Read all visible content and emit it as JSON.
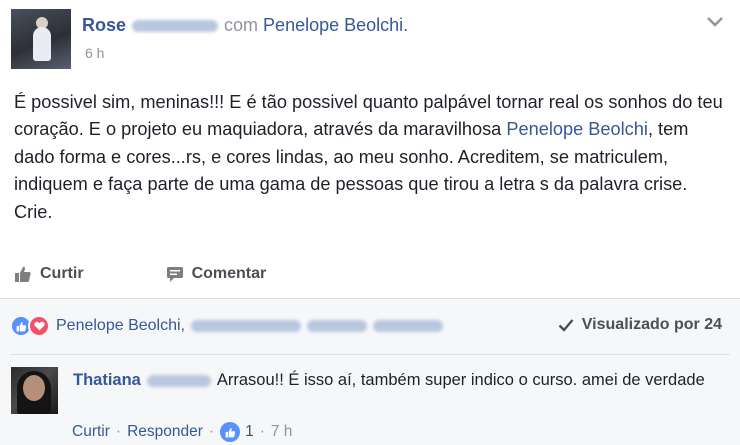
{
  "post": {
    "author_first": "Rose",
    "with_text": "com",
    "tagged": "Penelope Beolchi.",
    "time": "6 h",
    "text_before_link": "É possivel sim, meninas!!! E é tão possivel quanto palpável tornar real os sonhos do teu coração. E o projeto eu maquiadora, através da maravilhosa ",
    "text_link": "Penelope Beolchi",
    "text_after_link": ", tem dado forma e cores...rs, e cores lindas, ao meu sonho. Acreditem, se matriculem, indiquem e faça parte de uma gama de pessoas que tirou a letra s da palavra crise. Crie."
  },
  "actions": {
    "like": "Curtir",
    "comment": "Comentar"
  },
  "reactions": {
    "names": "Penelope Beolchi,",
    "seen": "Visualizado por 24"
  },
  "comment": {
    "name": "Thatiana",
    "text": "Arrasou!! É isso aí, também super indico o curso. amei de verdade",
    "like": "Curtir",
    "reply": "Responder",
    "likes": "1",
    "time": "7 h"
  },
  "colors": {
    "link": "#365899",
    "like_blue": "#5890ff",
    "love_red": "#f25268",
    "muted": "#90949c"
  },
  "icons": [
    "avatar",
    "chevron-down-icon",
    "thumbs-up-icon",
    "comment-icon",
    "like-reaction-icon",
    "love-reaction-icon",
    "checkmark-icon"
  ]
}
